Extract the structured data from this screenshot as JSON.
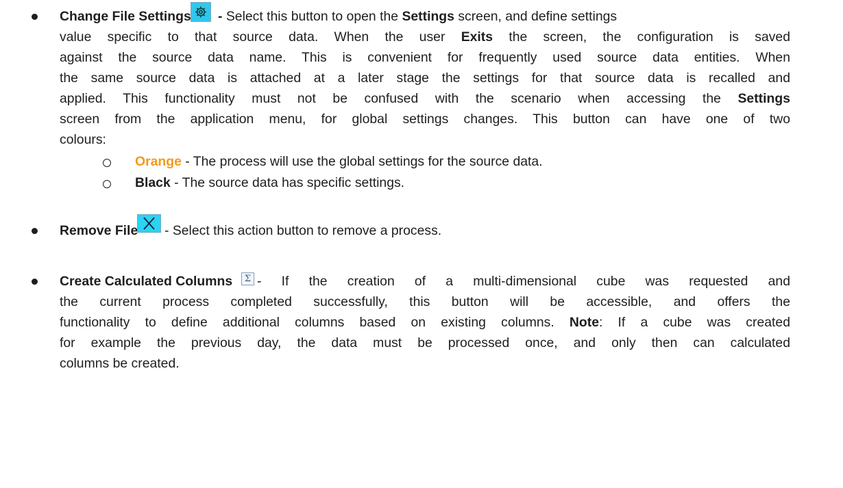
{
  "change_file_settings": {
    "title": "Change File Settings",
    "icon": "gear-icon",
    "line1_rest_a": " - ",
    "line1_rest_b": "Select this button to open the ",
    "line1_bold": "Settings",
    "line1_rest_c": " screen, and define settings",
    "line2_a": "value specific to that source data. When the user ",
    "line2_bold": "Exits",
    "line2_b": " the screen, the configuration is saved",
    "line3": "against the source data name. This is convenient for frequently used source data entities. When",
    "line4": "the same source data is attached at a later stage the settings for that source data is recalled and",
    "line5_a": "applied. This functionality must not be confused with the scenario when accessing the ",
    "line5_bold": "Settings",
    "line6": "screen from the application menu, for global settings changes. This button can have one of two",
    "line7": "colours:",
    "sub1_bold": "Orange",
    "sub1_rest": " - The process will use the global settings for the source data.",
    "sub2_bold": "Black",
    "sub2_rest": " - The source data has specific settings."
  },
  "remove_file": {
    "title": "Remove File",
    "icon": "close-icon",
    "rest": " - Select this action button to remove a process."
  },
  "create_calculated_columns": {
    "title": "Create Calculated Columns",
    "icon": "sigma-icon",
    "line1_rest": "- If the creation of a multi-dimensional cube was requested and",
    "line2": "the current process completed successfully, this button will be accessible, and offers the",
    "line3_a": "functionality to define additional columns based on existing columns. ",
    "line3_bold": "Note",
    "line3_b": ": If a cube was created",
    "line4": "for example the previous day, the data must be processed once, and only then can calculated",
    "line5": "columns be created."
  },
  "colors": {
    "orange": "#F39A1A",
    "button_cyan": "#2ec8f0"
  }
}
